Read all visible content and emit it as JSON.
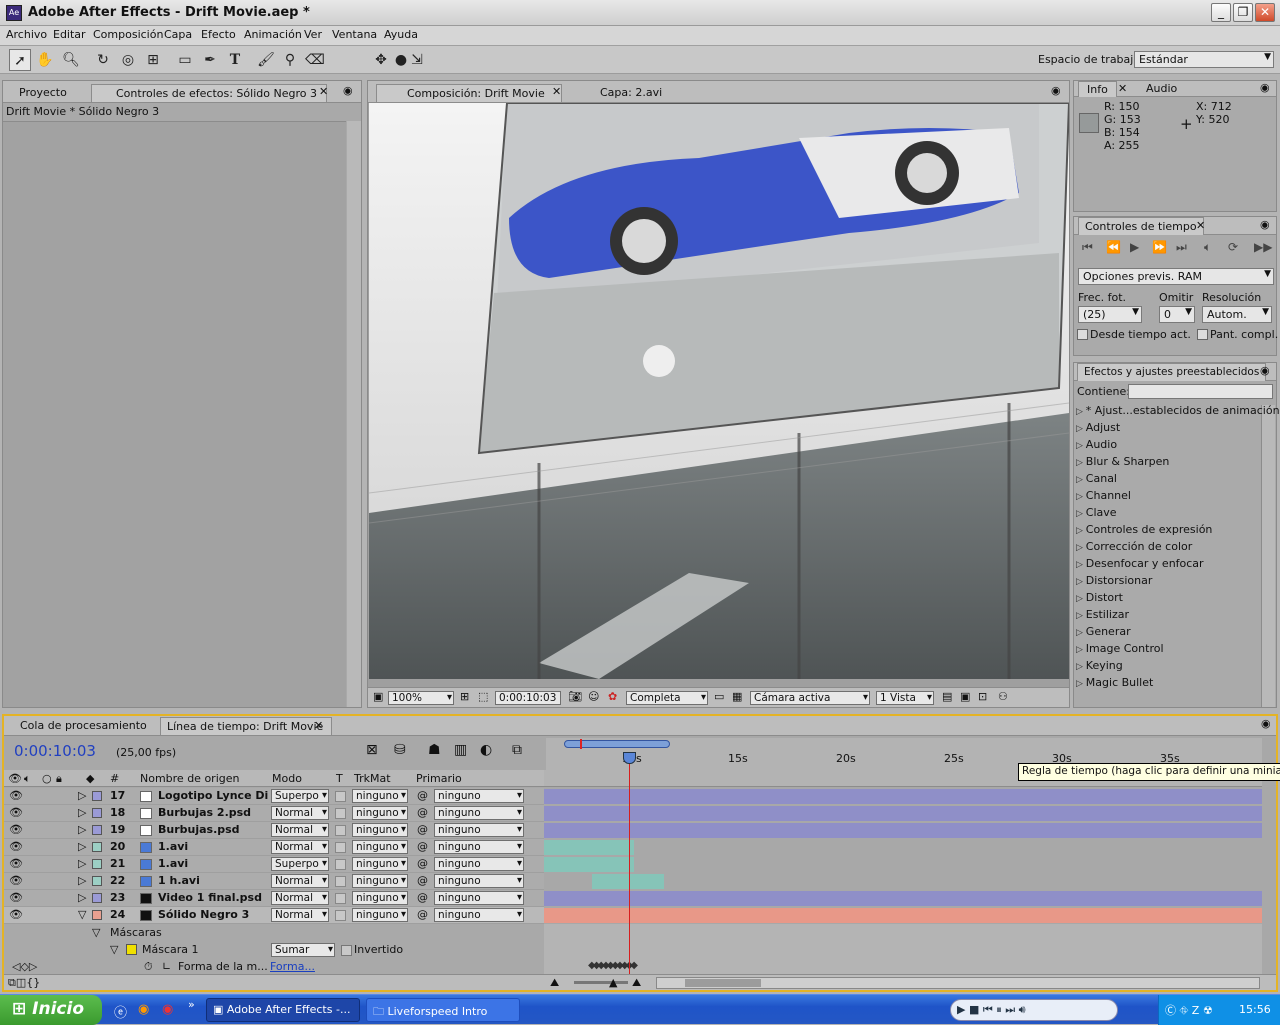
{
  "window": {
    "title": "Adobe After Effects - Drift Movie.aep *",
    "icon": "after-effects-icon"
  },
  "menu": [
    "Archivo",
    "Editar",
    "Composición",
    "Capa",
    "Efecto",
    "Animación",
    "Ver",
    "Ventana",
    "Ayuda"
  ],
  "workspace": {
    "label": "Espacio de trabajo",
    "value": "Estándar"
  },
  "project_panel": {
    "tab_project": "Proyecto",
    "tab_effects": "Controles de efectos: Sólido Negro 3",
    "breadcrumb": "Drift Movie * Sólido Negro 3"
  },
  "comp_panel": {
    "tab_comp": "Composición: Drift Movie",
    "tab_layer": "Capa: 2.avi",
    "zoom": "100%",
    "timecode": "0:00:10:03",
    "resolution": "Completa",
    "camera": "Cámara activa",
    "views": "1 Vista"
  },
  "info": {
    "tab": "Info",
    "tab_audio": "Audio",
    "r": "R:  150",
    "g": "G:  153",
    "b": "B:  154",
    "a": "A:  255",
    "x": "X:  712",
    "y": "Y:  520",
    "swatch": "#969a9a"
  },
  "time_controls": {
    "title": "Controles de tiempo",
    "ram": "Opciones previs. RAM",
    "fps_label": "Frec. fot.",
    "fps": "(25)",
    "skip_label": "Omitir",
    "skip": "0",
    "res_label": "Resolución",
    "res": "Autom.",
    "from_current": "Desde tiempo act.",
    "full_screen": "Pant. compl."
  },
  "effects": {
    "title": "Efectos y ajustes preestablecidos",
    "contains": "Contiene:",
    "items": [
      "* Ajust...establecidos de animación",
      "Adjust",
      "Audio",
      "Blur & Sharpen",
      "Canal",
      "Channel",
      "Clave",
      "Controles de expresión",
      "Corrección de color",
      "Desenfocar y enfocar",
      "Distorsionar",
      "Distort",
      "Estilizar",
      "Generar",
      "Image Control",
      "Keying",
      "Magic Bullet"
    ]
  },
  "timeline": {
    "tab_render": "Cola de procesamiento",
    "tab_timeline": "Línea de tiempo: Drift Movie",
    "timecode": "0:00:10:03",
    "fps": "(25,00 fps)",
    "tooltip": "Regla de tiempo (haga clic para definir una miniatura)",
    "ruler": [
      "10s",
      "15s",
      "20s",
      "25s",
      "30s",
      "35s"
    ],
    "headers": {
      "num": "#",
      "name": "Nombre de origen",
      "mode": "Modo",
      "t": "T",
      "trkmat": "TrkMat",
      "parent": "Primario"
    },
    "layers": [
      {
        "num": "17",
        "name": "Logotipo Lynce Di",
        "mode": "Superpo",
        "trk": "ninguno",
        "parent": "ninguno",
        "label": "#9a9ad6"
      },
      {
        "num": "18",
        "name": "Burbujas 2.psd",
        "mode": "Normal",
        "trk": "ninguno",
        "parent": "ninguno",
        "label": "#9a9ad6"
      },
      {
        "num": "19",
        "name": "Burbujas.psd",
        "mode": "Normal",
        "trk": "ninguno",
        "parent": "ninguno",
        "label": "#9a9ad6"
      },
      {
        "num": "20",
        "name": "1.avi",
        "mode": "Normal",
        "trk": "ninguno",
        "parent": "ninguno",
        "label": "#9ccfc4"
      },
      {
        "num": "21",
        "name": "1.avi",
        "mode": "Superpo",
        "trk": "ninguno",
        "parent": "ninguno",
        "label": "#9ccfc4"
      },
      {
        "num": "22",
        "name": "1 h.avi",
        "mode": "Normal",
        "trk": "ninguno",
        "parent": "ninguno",
        "label": "#9ccfc4"
      },
      {
        "num": "23",
        "name": "Video 1 final.psd",
        "mode": "Normal",
        "trk": "ninguno",
        "parent": "ninguno",
        "label": "#9a9ad6"
      },
      {
        "num": "24",
        "name": "Sólido Negro 3",
        "mode": "Normal",
        "trk": "ninguno",
        "parent": "ninguno",
        "label": "#e8a090"
      }
    ],
    "masks": "Máscaras",
    "mask1": "Máscara 1",
    "mask_mode": "Sumar",
    "inverted": "Invertido",
    "mask_shape": "Forma de la m...",
    "shape_link": "Forma..."
  },
  "taskbar": {
    "start": "Inicio",
    "task1": "Adobe After Effects -...",
    "task2": "Liveforspeed Intro",
    "clock": "15:56"
  }
}
